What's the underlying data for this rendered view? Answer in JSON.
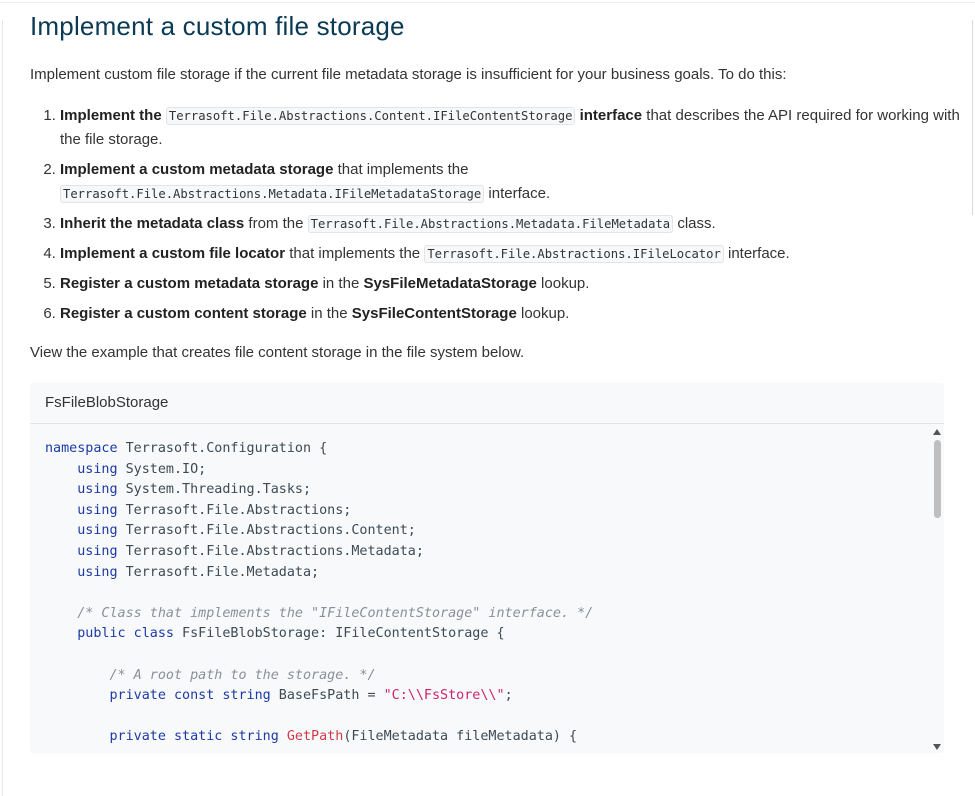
{
  "title": "Implement a custom file storage",
  "intro": "Implement custom file storage if the current file metadata storage is insufficient for your business goals. To do this:",
  "steps": [
    {
      "bold": "Implement the",
      "code": "Terrasoft.File.Abstractions.Content.IFileContentStorage",
      "bold2": "interface",
      "rest": "that describes the API required for working with the file storage."
    },
    {
      "bold": "Implement a custom metadata storage",
      "rest": "that implements the",
      "code": "Terrasoft.File.Abstractions.Metadata.IFileMetadataStorage",
      "rest2": "interface."
    },
    {
      "bold": "Inherit the metadata class",
      "rest": "from the",
      "code": "Terrasoft.File.Abstractions.Metadata.FileMetadata",
      "rest2": "class."
    },
    {
      "bold": "Implement a custom file locator",
      "rest": "that implements the",
      "code": "Terrasoft.File.Abstractions.IFileLocator",
      "rest2": "interface."
    },
    {
      "bold": "Register a custom metadata storage",
      "rest": "in the",
      "bold2": "SysFileMetadataStorage",
      "rest2": "lookup."
    },
    {
      "bold": "Register a custom content storage",
      "rest": "in the",
      "bold2": "SysFileContentStorage",
      "rest2": "lookup."
    }
  ],
  "view_text": "View the example that creates file content storage in the file system below.",
  "code_block": {
    "tab_label": "FsFileBlobStorage",
    "lines": [
      "namespace Terrasoft.Configuration {",
      "    using System.IO;",
      "    using System.Threading.Tasks;",
      "    using Terrasoft.File.Abstractions;",
      "    using Terrasoft.File.Abstractions.Content;",
      "    using Terrasoft.File.Abstractions.Metadata;",
      "    using Terrasoft.File.Metadata;",
      "",
      "    /* Class that implements the \"IFileContentStorage\" interface. */",
      "    public class FsFileBlobStorage: IFileContentStorage {",
      "",
      "        /* A root path to the storage. */",
      "        private const string BaseFsPath = \"C:\\\\FsStore\\\\\";",
      "",
      "        private static string GetPath(FileMetadata fileMetadata) {"
    ]
  }
}
